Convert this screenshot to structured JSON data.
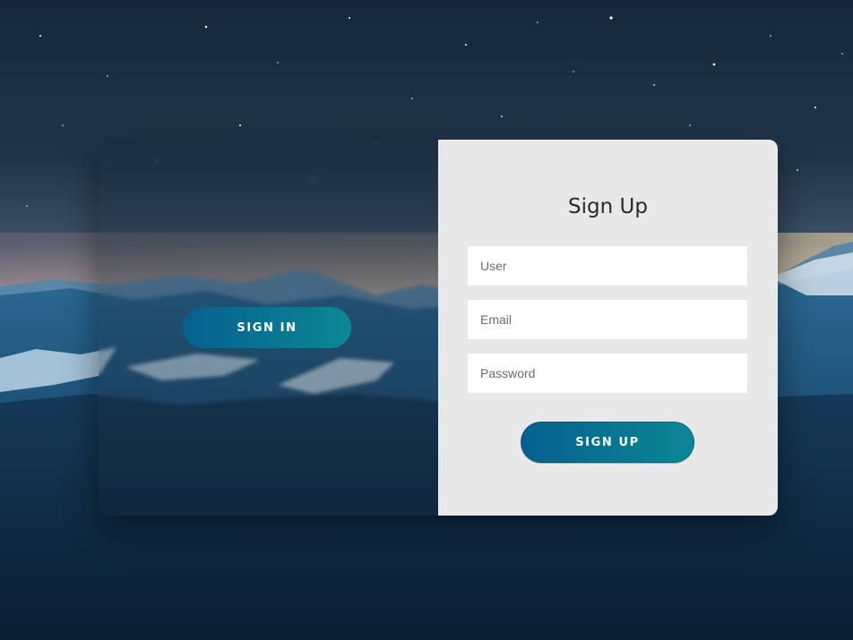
{
  "left_panel": {
    "signin_button_label": "SIGN IN"
  },
  "right_panel": {
    "title": "Sign Up",
    "fields": {
      "user": {
        "value": "",
        "placeholder": "User"
      },
      "email": {
        "value": "",
        "placeholder": "Email"
      },
      "password": {
        "value": "",
        "placeholder": "Password"
      }
    },
    "signup_button_label": "SIGN UP"
  },
  "colors": {
    "button_gradient_start": "#07608f",
    "button_gradient_end": "#0a8894",
    "form_panel_bg": "#e8e8e8",
    "field_bg": "#ffffff"
  },
  "background": {
    "description_icon": "night-mountain-landscape"
  }
}
